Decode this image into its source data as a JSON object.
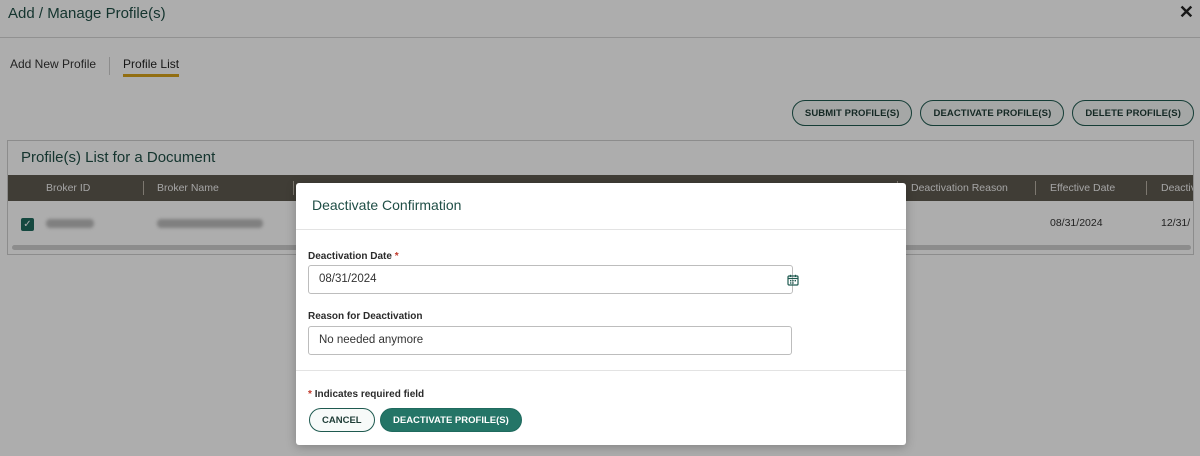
{
  "header": {
    "title": "Add / Manage Profile(s)",
    "close": "✕"
  },
  "tabs": [
    {
      "label": "Add New Profile",
      "active": false
    },
    {
      "label": "Profile List",
      "active": true
    }
  ],
  "actions": {
    "submit": "SUBMIT PROFILE(S)",
    "deactivate": "DEACTIVATE PROFILE(S)",
    "delete": "DELETE PROFILE(S)"
  },
  "list": {
    "title": "Profile(s) List for a Document",
    "columns": [
      "Broker ID",
      "Broker Name",
      "Deactivation Reason",
      "Effective Date",
      "Deactiv"
    ],
    "row": {
      "checked": true,
      "effective_date": "08/31/2024",
      "deactivation_date_partial": "12/31/"
    }
  },
  "modal": {
    "title": "Deactivate Confirmation",
    "date_label": "Deactivation Date",
    "required_mark": "*",
    "date_value": "08/31/2024",
    "reason_label": "Reason for Deactivation",
    "reason_value": "No needed anymore",
    "required_note": "Indicates required field",
    "cancel": "CANCEL",
    "confirm": "DEACTIVATE PROFILE(S)"
  },
  "colors": {
    "accent": "#1f4e46",
    "primary_button": "#247567",
    "tab_underline": "#d8a31a",
    "table_header": "#5f5a50"
  }
}
